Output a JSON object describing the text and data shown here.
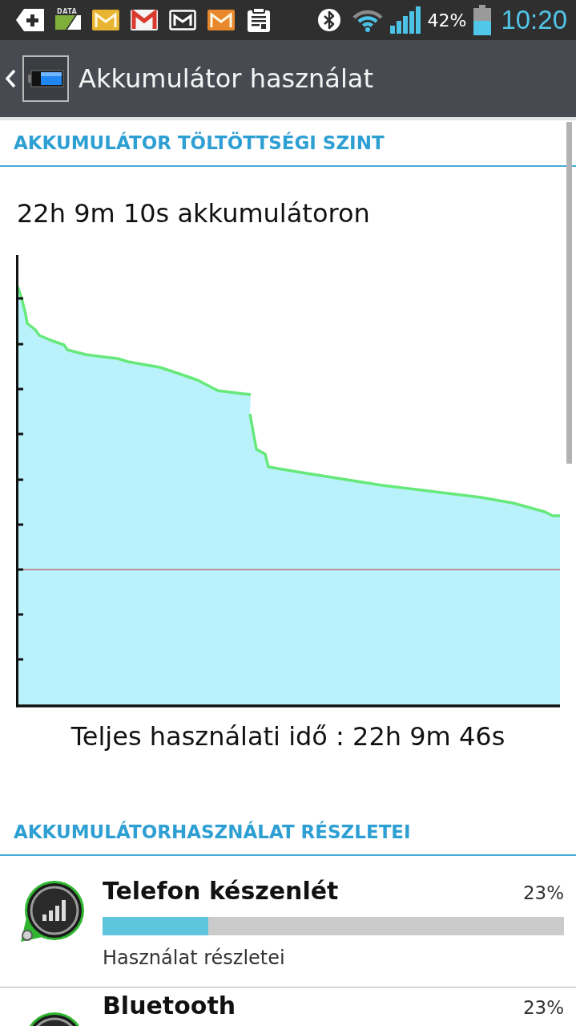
{
  "status_bar": {
    "notifications": [
      {
        "kind": "tag"
      },
      {
        "kind": "data",
        "label": "DATA"
      },
      {
        "kind": "mail",
        "color": "#e9b431"
      },
      {
        "kind": "gmail",
        "color": "#d93a2e"
      },
      {
        "kind": "mail-outline",
        "color": "#ffffff"
      },
      {
        "kind": "mail",
        "color": "#e8872b"
      },
      {
        "kind": "clipboard"
      }
    ],
    "battery_percent": "42%",
    "time": "10:20"
  },
  "header": {
    "title": "Akkumulátor használat"
  },
  "charge_section": {
    "heading": "AKKUMULÁTOR TÖLTÖTTSÉGI SZINT",
    "on_battery": "22h 9m 10s akkumulátoron",
    "total_usage": "Teljes használati idő : 22h 9m 46s"
  },
  "usage_section": {
    "heading": "AKKUMULÁTORHASZNÁLAT RÉSZLETEI",
    "items": [
      {
        "name": "Telefon készenlét",
        "percent": "23%",
        "level": 0.23,
        "detail": "Használat részletei"
      },
      {
        "name": "Bluetooth",
        "percent": "23%"
      }
    ]
  }
}
